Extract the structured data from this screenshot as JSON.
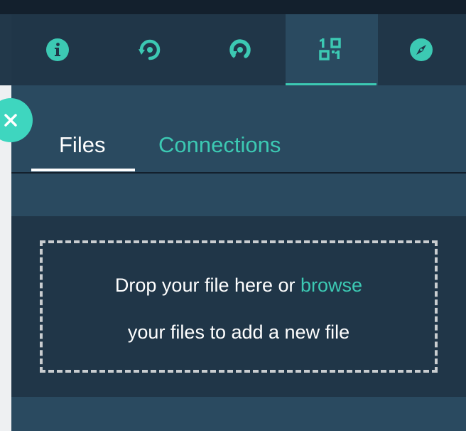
{
  "toolbar": {
    "items": [
      {
        "icon": "info-icon"
      },
      {
        "icon": "refresh-location-icon"
      },
      {
        "icon": "sync-icon"
      },
      {
        "icon": "qr-code-icon",
        "active": true
      },
      {
        "icon": "compass-icon"
      }
    ]
  },
  "tabs": {
    "files": "Files",
    "connections": "Connections",
    "active": "Files"
  },
  "dropzone": {
    "text_before": "Drop your file here or ",
    "browse": "browse",
    "text_after": "your files to add a new file"
  },
  "colors": {
    "accent": "#3cc9b3",
    "toolbar_bg": "#203648",
    "panel_bg": "#2a4a60",
    "dropzone_bg": "#203648",
    "close_button": "#3ed6bf"
  }
}
